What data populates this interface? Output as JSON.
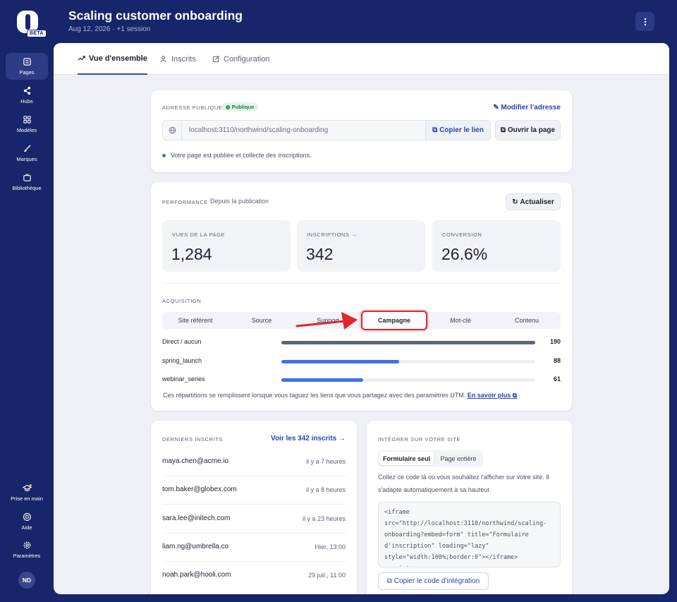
{
  "sidebar": {
    "logo_badge": "BETA",
    "items": [
      {
        "label": "Pages",
        "icon": "pages-icon"
      },
      {
        "label": "Hubs",
        "icon": "share-icon"
      },
      {
        "label": "Modèles",
        "icon": "grid-icon"
      },
      {
        "label": "Marques",
        "icon": "brush-icon"
      },
      {
        "label": "Bibliothèque",
        "icon": "tv-icon"
      }
    ],
    "bottom_items": [
      {
        "label": "Prise en main",
        "icon": "graduation-cap-icon"
      },
      {
        "label": "Aide",
        "icon": "lifebuoy-icon"
      },
      {
        "label": "Paramètres",
        "icon": "gear-icon"
      }
    ],
    "avatar_initials": "ND"
  },
  "header": {
    "title": "Scaling customer onboarding",
    "subtitle": "Aug 12, 2026 · +1 session"
  },
  "tabs": [
    {
      "label": "Vue d'ensemble",
      "icon": "trend-icon",
      "active": true
    },
    {
      "label": "Inscrits",
      "icon": "users-icon",
      "active": false
    },
    {
      "label": "Configuration",
      "icon": "edit-icon",
      "active": false
    }
  ],
  "public_address": {
    "label": "ADRESSE PUBLIQUE",
    "badge": "Publique",
    "edit_link": "Modifier l'adresse",
    "url": "localhost:3110/northwind/scaling-onboarding",
    "copy_button": "Copier le lien",
    "open_button": "Ouvrir la page",
    "status": "Votre page est publiée et collecte des inscriptions."
  },
  "performance": {
    "label": "PERFORMANCE",
    "since": "Depuis la publication",
    "refresh_button": "Actualiser",
    "stats": [
      {
        "label": "VUES DE LA PAGE",
        "value": "1,284"
      },
      {
        "label": "INSCRIPTIONS →",
        "value": "342"
      },
      {
        "label": "CONVERSION",
        "value": "26.6%"
      }
    ],
    "acquisition_label": "ACQUISITION",
    "acquisition_tabs": [
      "Site référent",
      "Source",
      "Support",
      "Campagne",
      "Mot-clé",
      "Contenu"
    ],
    "selected_tab": "Campagne",
    "rows": [
      {
        "label": "Direct / aucun",
        "value": 190,
        "display": "190",
        "color": "#5b6675"
      },
      {
        "label": "spring_launch",
        "value": 88,
        "display": "88",
        "color": "#3e73e4"
      },
      {
        "label": "webinar_series",
        "value": 61,
        "display": "61",
        "color": "#3e73e4"
      }
    ],
    "note": "Ces répartitions se remplissent lorsque vous taguez les liens que vous partagez avec des paramètres UTM.",
    "learn_more": "En savoir plus"
  },
  "recent": {
    "label": "DERNIERS INSCRITS",
    "view_all": "Voir les 342 inscrits →",
    "items": [
      {
        "email": "maya.chen@acme.io",
        "when": "il y a 7 heures"
      },
      {
        "email": "tom.baker@globex.com",
        "when": "il y a 8 heures"
      },
      {
        "email": "sara.lee@initech.com",
        "when": "il y a 23 heures"
      },
      {
        "email": "liam.ng@umbrella.co",
        "when": "Hier, 13:00"
      },
      {
        "email": "noah.park@hooli.com",
        "when": "29 juil., 11:00"
      }
    ]
  },
  "embed": {
    "label": "INTÉGRER SUR VOTRE SITE",
    "options": [
      "Formulaire seul",
      "Page entière"
    ],
    "selected": "Formulaire seul",
    "description": "Collez ce code là où vous souhaitez l'afficher sur votre site. Il s'adapte automatiquement à sa hauteur.",
    "code": "<iframe\nsrc=\"http://localhost:3110/northwind/scaling-\nonboarding?embed=form\" title=\"Formulaire\nd'inscription\" loading=\"lazy\"\nstyle=\"width:100%;border:0\"></iframe>\n<script>",
    "copy_button": "Copier le code d'intégration"
  },
  "colors": {
    "sidebar_bg": "#17266a",
    "accent": "#2547a8",
    "bar_dark": "#5b6675",
    "bar_blue": "#3e73e4",
    "highlight": "#e0262c"
  }
}
